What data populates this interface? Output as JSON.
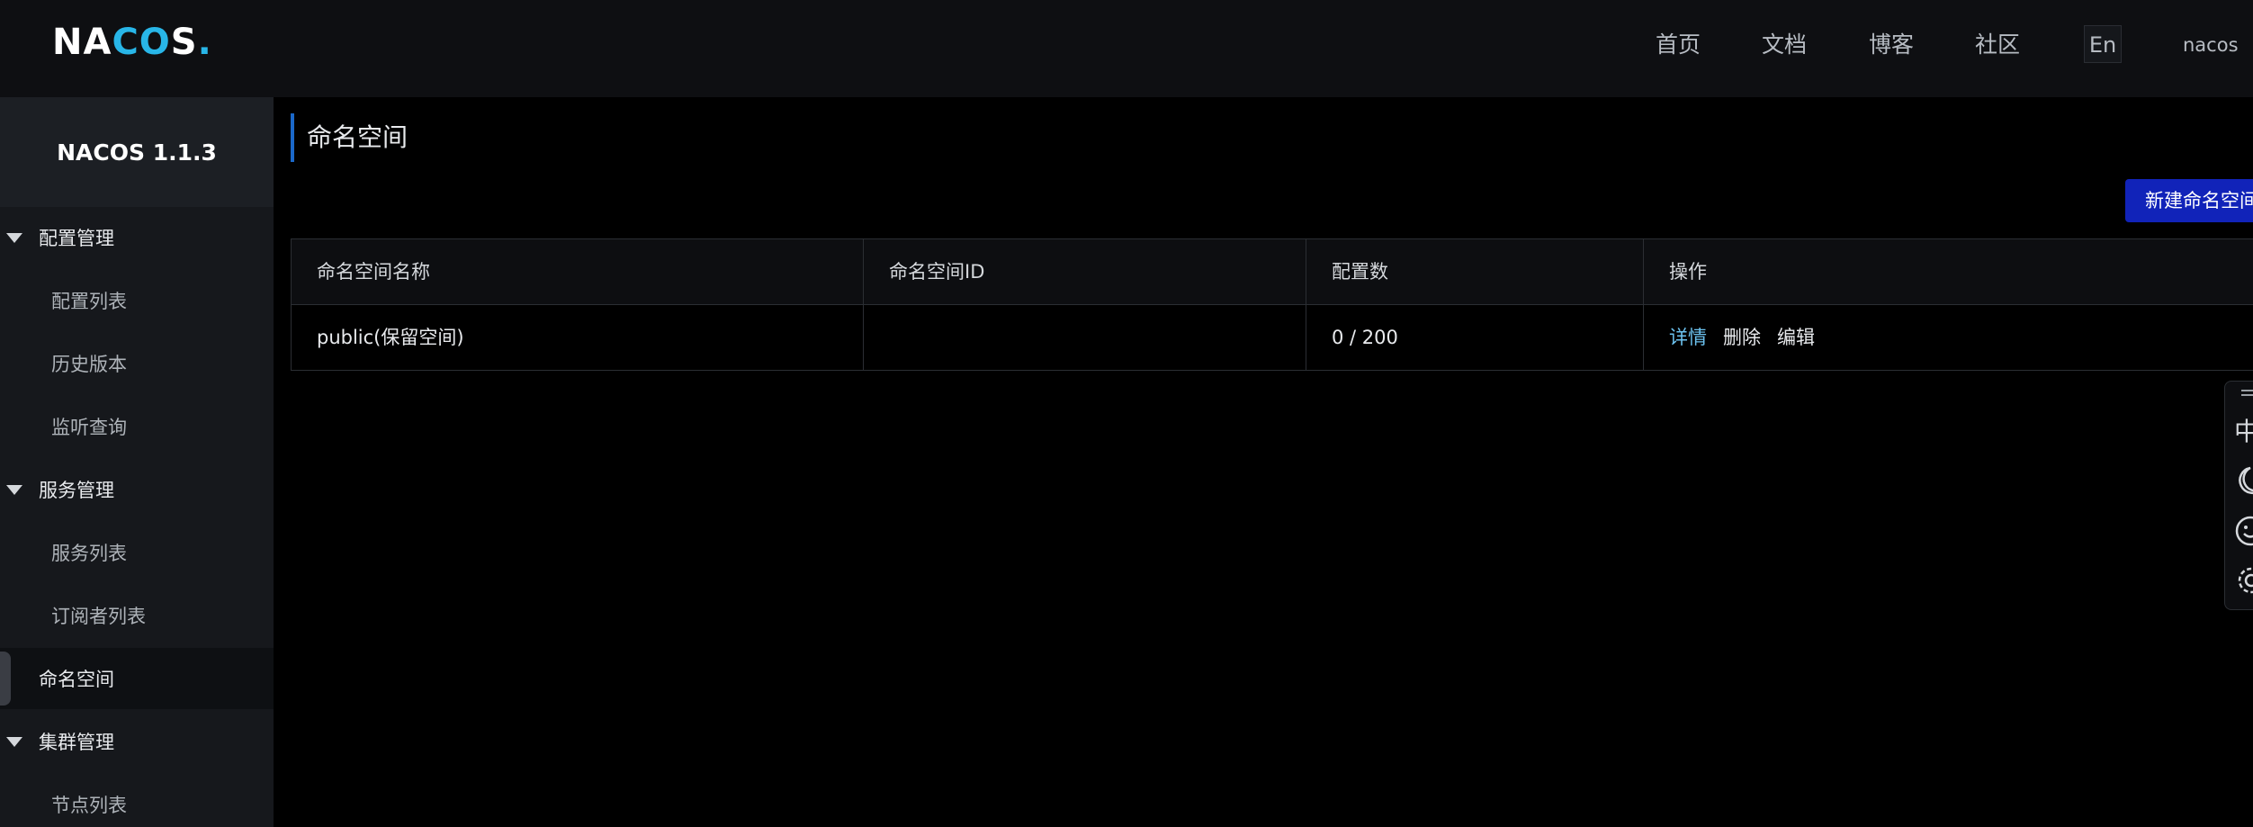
{
  "header": {
    "logo_text_1": "NA",
    "logo_text_2": "CO",
    "logo_text_3": "S",
    "logo_text_dot": ".",
    "nav": [
      "首页",
      "文档",
      "博客",
      "社区"
    ],
    "lang_label": "En",
    "username": "nacos"
  },
  "sidebar": {
    "version": "NACOS 1.1.3",
    "groups": [
      {
        "label": "配置管理",
        "items": [
          "配置列表",
          "历史版本",
          "监听查询"
        ]
      },
      {
        "label": "服务管理",
        "items": [
          "服务列表",
          "订阅者列表"
        ]
      },
      {
        "label": "命名空间",
        "items": []
      },
      {
        "label": "集群管理",
        "items": [
          "节点列表"
        ]
      }
    ],
    "active_item": "命名空间"
  },
  "main": {
    "page_title": "命名空间",
    "create_button": "新建命名空间",
    "table": {
      "headers": [
        "命名空间名称",
        "命名空间ID",
        "配置数",
        "操作"
      ],
      "rows": [
        {
          "name": "public(保留空间)",
          "id": "",
          "config_count": "0 / 200",
          "actions": [
            "详情",
            "删除",
            "编辑"
          ]
        }
      ]
    }
  },
  "side_tools": {
    "lang_toggle": "中",
    "icons": [
      "drag-handle-icon",
      "moon-icon",
      "smile-icon",
      "gear-icon"
    ]
  },
  "colors": {
    "accent_blue": "#1123b9",
    "link_blue": "#6cc2ef",
    "title_bar": "#1b68c9"
  }
}
